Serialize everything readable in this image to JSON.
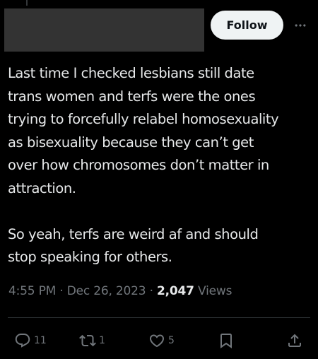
{
  "header": {
    "follow_label": "Follow",
    "more_icon": "more-horizontal-icon"
  },
  "tweet": {
    "paragraphs": [
      [
        "Last time I checked lesbians still date",
        "trans women and terfs were the ones",
        "trying to forcefully relabel homosexuality",
        "as bisexuality because they can’t get",
        "over how chromosomes don’t matter in",
        "attraction."
      ],
      [
        "So yeah, terfs are weird af and should",
        "stop speaking for others."
      ]
    ],
    "time": "4:55 PM",
    "date": "Dec 26, 2023",
    "separator": "·",
    "views_count": "2,047",
    "views_label": "Views"
  },
  "actions": {
    "reply_count": "11",
    "repost_count": "1",
    "like_count": "5"
  },
  "colors": {
    "background": "#000000",
    "text": "#e7e9ea",
    "muted": "#71767b",
    "follow_bg": "#eff3f4"
  }
}
